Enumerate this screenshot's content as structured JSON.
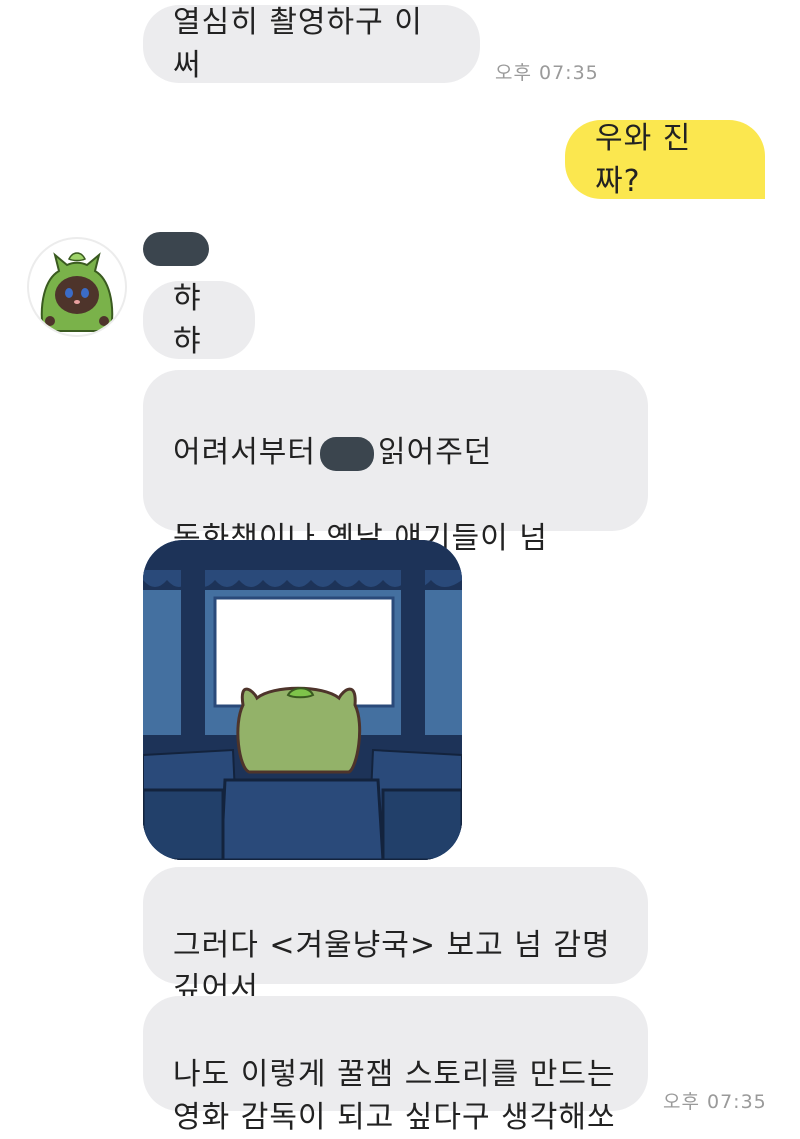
{
  "colors": {
    "bubble_other": "#ececee",
    "bubble_me": "#fbe74f",
    "timestamp": "#9a9a9a",
    "background": "#ffffff"
  },
  "messages": {
    "m1": {
      "text": "열심히 촬영하구 이써",
      "time": "오후 07:35"
    },
    "m2": {
      "text": "우와 진짜?"
    },
    "m3": {
      "text": "햐햐"
    },
    "m4": {
      "line1_pre": "어려서부터",
      "line1_post": "읽어주던",
      "rest": "동화책이나 옛날 얘기들이 넘\n재밌었거든"
    },
    "m5": {
      "text": "그러다 <겨울냥국> 보고 넘 감명\n깊어서"
    },
    "m6": {
      "text": "나도 이렇게 꿀잼 스토리를 만드는\n영화 감독이 되고 싶다구 생각해쏘",
      "time": "오후 07:35"
    }
  },
  "sender": {
    "avatar_icon": "cat-with-leaf-hood-icon"
  },
  "sticker": {
    "icon": "cat-watching-movie-sticker"
  }
}
